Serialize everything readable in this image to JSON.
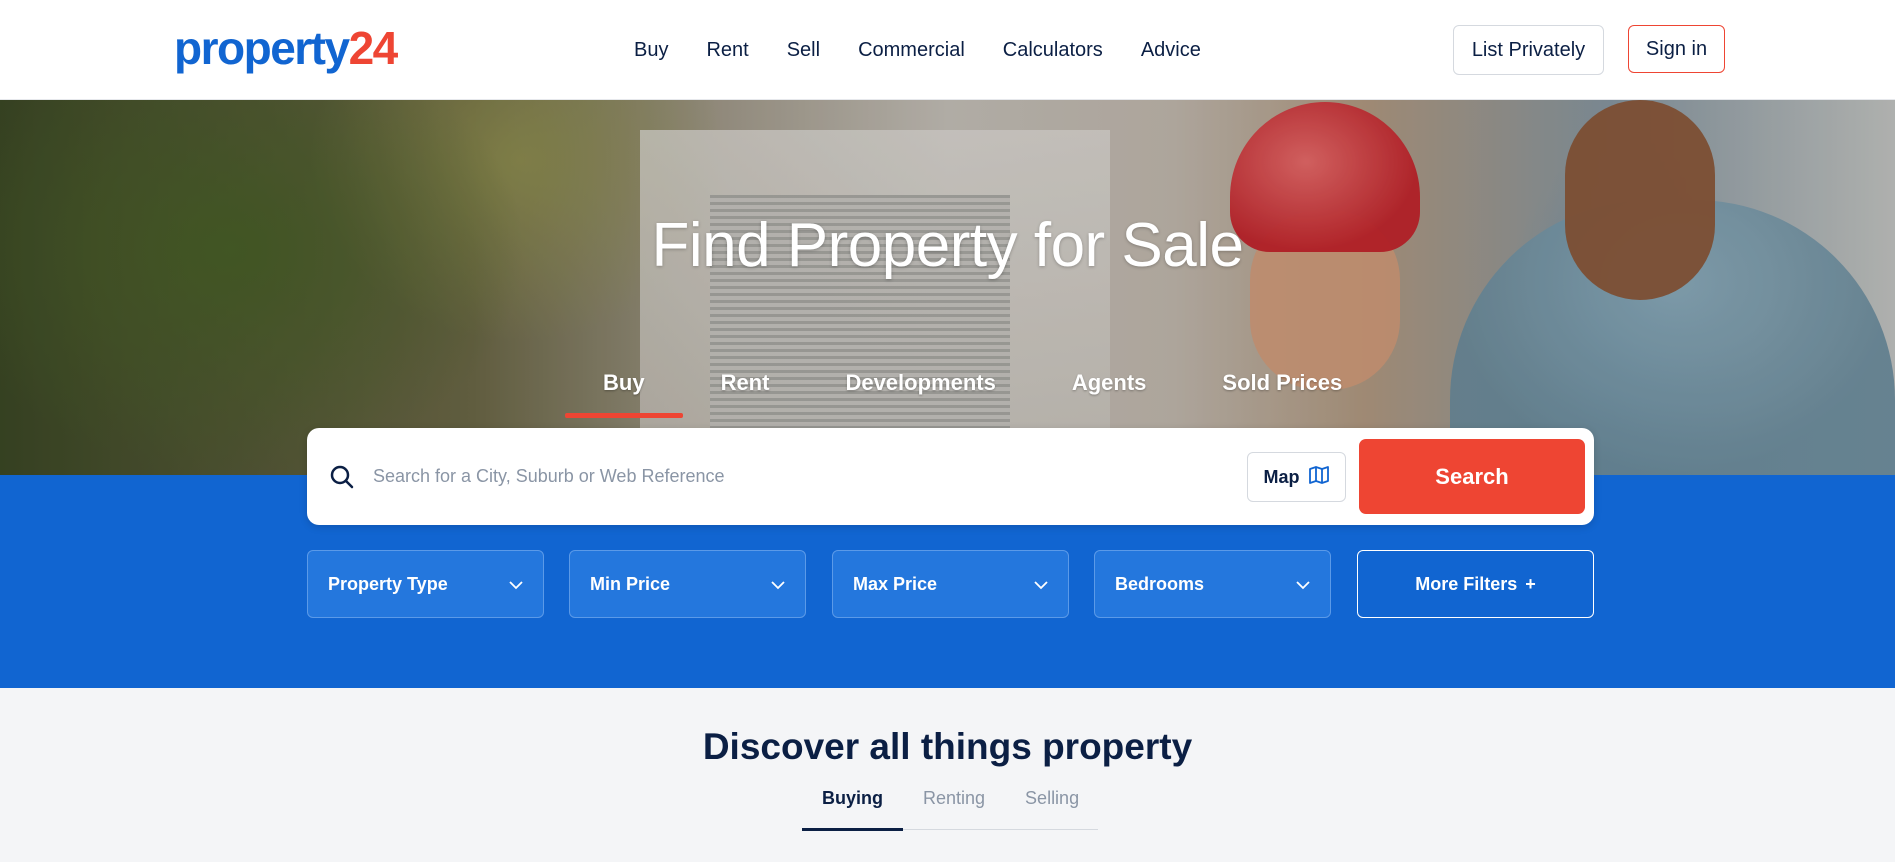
{
  "header": {
    "logo_part1": "property",
    "logo_part2": "24",
    "nav": [
      "Buy",
      "Rent",
      "Sell",
      "Commercial",
      "Calculators",
      "Advice"
    ],
    "list_privately": "List Privately",
    "sign_in": "Sign in"
  },
  "hero": {
    "title": "Find Property for Sale",
    "tabs": [
      "Buy",
      "Rent",
      "Developments",
      "Agents",
      "Sold Prices"
    ],
    "active_tab": "Buy"
  },
  "search": {
    "placeholder": "Search for a City, Suburb or Web Reference",
    "value": "",
    "map_label": "Map",
    "button_label": "Search"
  },
  "filters": {
    "property_type": "Property Type",
    "min_price": "Min Price",
    "max_price": "Max Price",
    "bedrooms": "Bedrooms",
    "more_filters": "More Filters",
    "more_filters_icon": "+"
  },
  "discover": {
    "title": "Discover all things property",
    "tabs": [
      "Buying",
      "Renting",
      "Selling"
    ],
    "active_tab": "Buying"
  },
  "colors": {
    "brand_blue": "#1165d1",
    "brand_red": "#ee4533",
    "text_dark": "#0b1f44"
  },
  "icons": {
    "search": "search-icon",
    "map": "map-icon",
    "chevron": "chevron-down-icon",
    "plus": "plus-icon"
  }
}
